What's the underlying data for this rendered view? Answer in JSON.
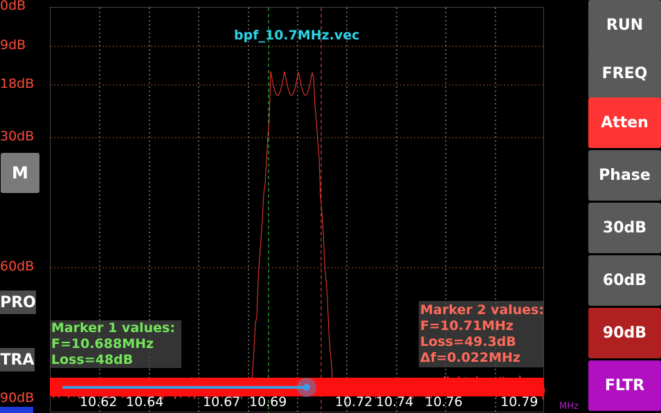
{
  "y_axis": {
    "labels": [
      "0dB",
      "9dB",
      "18dB",
      "30dB",
      "60dB",
      "90dB"
    ]
  },
  "left_buttons": {
    "m": "M",
    "pro": "PRO",
    "tra": "TRA"
  },
  "trace": {
    "title": "bpf_10.7MHz.vec",
    "color": "#ff3b30"
  },
  "marker1": {
    "title": "Marker 1 values:",
    "freq": "F=10.688MHz",
    "loss": "Loss=48dB",
    "color": "#73e65a"
  },
  "marker2": {
    "title": "Marker 2 values:",
    "freq": "F=10.71MHz",
    "loss": "Loss=49.3dB",
    "delta": "Δf=0.022MHz",
    "color": "#ff6a5a"
  },
  "x_axis": {
    "ticks": [
      "10.62",
      "10.64",
      "10.67",
      "10.69",
      "10.72",
      "10.74",
      "10.76",
      "10.79"
    ],
    "unit": "MHz"
  },
  "slider": {
    "position_fraction": 0.5
  },
  "right_buttons": [
    {
      "label": "RUN",
      "color": "#5a5a5a"
    },
    {
      "label": "FREQ",
      "color": "#5a5a5a"
    },
    {
      "label": "Atten",
      "color": "#ff3535"
    },
    {
      "label": "Phase",
      "color": "#5a5a5a"
    },
    {
      "label": "30dB",
      "color": "#5a5a5a"
    },
    {
      "label": "60dB",
      "color": "#5a5a5a"
    },
    {
      "label": "90dB",
      "color": "#b02020"
    },
    {
      "label": "FLTR",
      "color": "#b010c0"
    }
  ]
}
